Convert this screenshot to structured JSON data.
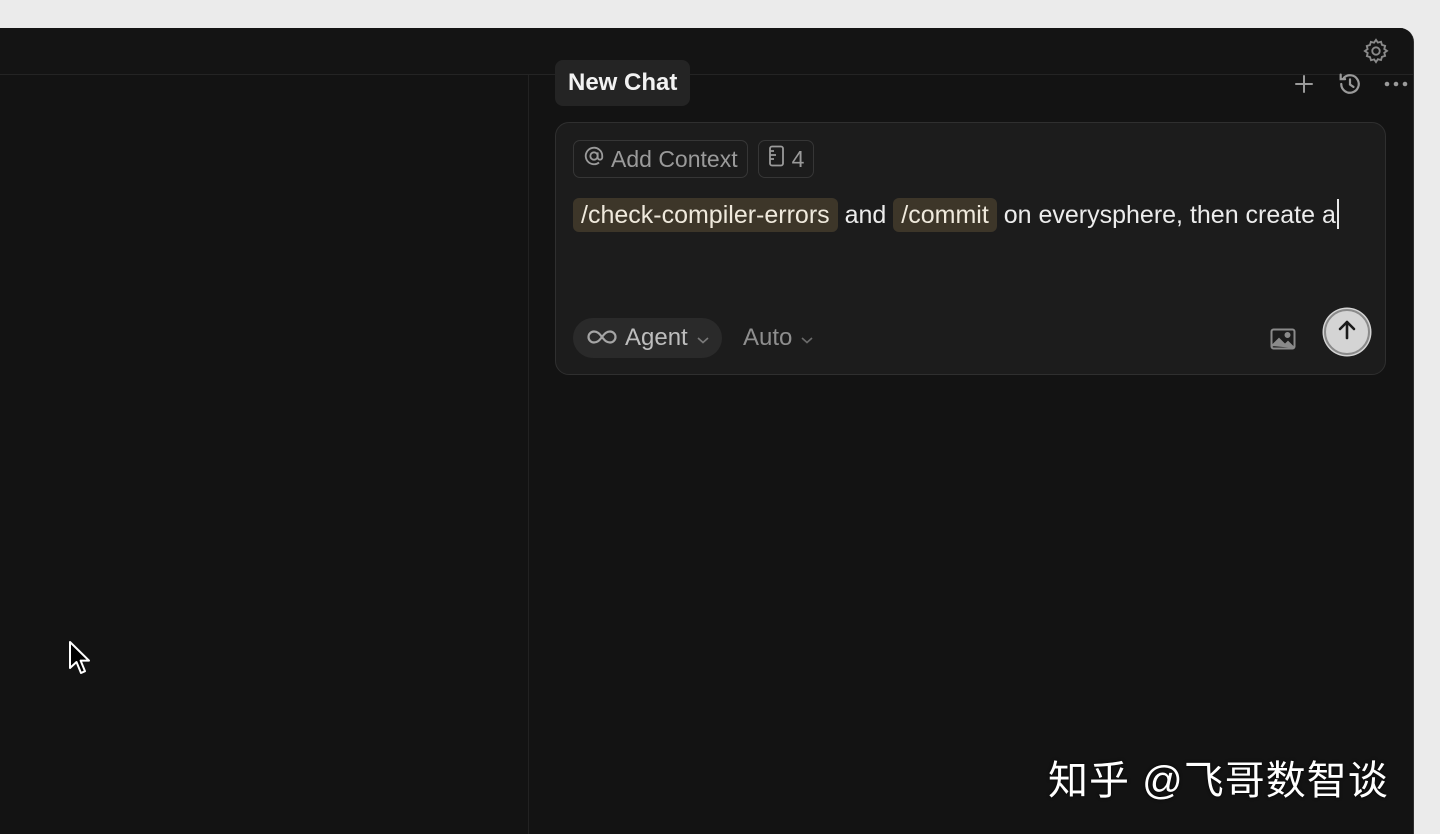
{
  "chat": {
    "tab_title": "New Chat",
    "header_icons": [
      "plus-icon",
      "history-icon",
      "more-icon"
    ]
  },
  "composer": {
    "add_context_label": "Add Context",
    "rules_count": "4",
    "text_parts": {
      "cmd1": "/check-compiler-errors",
      "t1": " and ",
      "cmd2": "/commit",
      "t2": " on everysphere, then create a"
    },
    "mode_label": "Agent",
    "model_label": "Auto"
  },
  "watermark": "知乎 @飞哥数智谈",
  "colors": {
    "background": "#131313",
    "composer_bg": "#1c1c1c",
    "command_highlight": "#3d3629",
    "send_button": "#d4d4d4"
  }
}
